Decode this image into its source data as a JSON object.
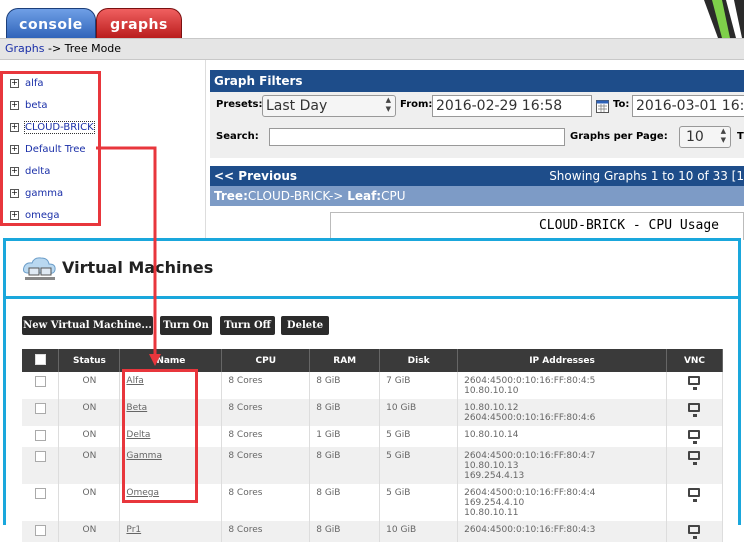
{
  "tabs": {
    "console": "console",
    "graphs": "graphs"
  },
  "breadcrumb": {
    "link": "Graphs",
    "separator": " -> ",
    "current": "Tree Mode"
  },
  "tree": {
    "items": [
      {
        "label": "alfa"
      },
      {
        "label": "beta"
      },
      {
        "label": "CLOUD-BRICK"
      },
      {
        "label": "Default Tree"
      },
      {
        "label": "delta"
      },
      {
        "label": "gamma"
      },
      {
        "label": "omega"
      }
    ]
  },
  "graph_filters": {
    "title": "Graph Filters",
    "presets_label": "Presets:",
    "presets_value": "Last Day",
    "from_label": "From:",
    "from_value": "2016-02-29 16:58",
    "to_label": "To:",
    "to_value": "2016-03-01 16:",
    "search_label": "Search:",
    "search_value": "",
    "graphs_per_page_label": "Graphs per Page:",
    "graphs_per_page_value": "10",
    "trailing_letter": "T"
  },
  "navigation": {
    "previous": "<< Previous",
    "showing": "Showing Graphs 1 to 10 of 33 [1"
  },
  "leaf_path": {
    "tree_label": "Tree:",
    "tree_value": "CLOUD-BRICK->",
    "leaf_label": "Leaf:",
    "leaf_value": "CPU"
  },
  "graph": {
    "title": "CLOUD-BRICK - CPU Usage"
  },
  "vm_panel": {
    "title": "Virtual Machines",
    "buttons": {
      "new_vm": "New Virtual Machine...",
      "turn_on": "Turn On",
      "turn_off": "Turn Off",
      "delete": "Delete"
    },
    "columns": {
      "status": "Status",
      "name": "Name",
      "cpu": "CPU",
      "ram": "RAM",
      "disk": "Disk",
      "ip": "IP Addresses",
      "vnc": "VNC"
    },
    "rows": [
      {
        "status": "ON",
        "name": "Alfa",
        "cpu": "8 Cores",
        "ram": "8 GiB",
        "disk": "7 GiB",
        "ip1": "2604:4500:0:10:16:FF:80:4:5",
        "ip2": "10.80.10.10",
        "ip3": ""
      },
      {
        "status": "ON",
        "name": "Beta",
        "cpu": "8 Cores",
        "ram": "8 GiB",
        "disk": "10 GiB",
        "ip1": "10.80.10.12",
        "ip2": "2604:4500:0:10:16:FF:80:4:6",
        "ip3": ""
      },
      {
        "status": "ON",
        "name": "Delta",
        "cpu": "8 Cores",
        "ram": "1 GiB",
        "disk": "5 GiB",
        "ip1": "10.80.10.14",
        "ip2": "",
        "ip3": ""
      },
      {
        "status": "ON",
        "name": "Gamma",
        "cpu": "8 Cores",
        "ram": "8 GiB",
        "disk": "5 GiB",
        "ip1": "2604:4500:0:10:16:FF:80:4:7",
        "ip2": "10.80.10.13",
        "ip3": "169.254.4.13"
      },
      {
        "status": "ON",
        "name": "Omega",
        "cpu": "8 Cores",
        "ram": "8 GiB",
        "disk": "5 GiB",
        "ip1": "2604:4500:0:10:16:FF:80:4:4",
        "ip2": "169.254.4.10",
        "ip3": "10.80.10.11"
      },
      {
        "status": "ON",
        "name": "Pr1",
        "cpu": "8 Cores",
        "ram": "8 GiB",
        "disk": "10 GiB",
        "ip1": "2604:4500:0:10:16:FF:80:4:3",
        "ip2": "",
        "ip3": ""
      }
    ]
  },
  "colors": {
    "highlight_red": "#e8363c",
    "panel_blue": "#1aa7dc",
    "filter_header": "#1e4d8a"
  }
}
